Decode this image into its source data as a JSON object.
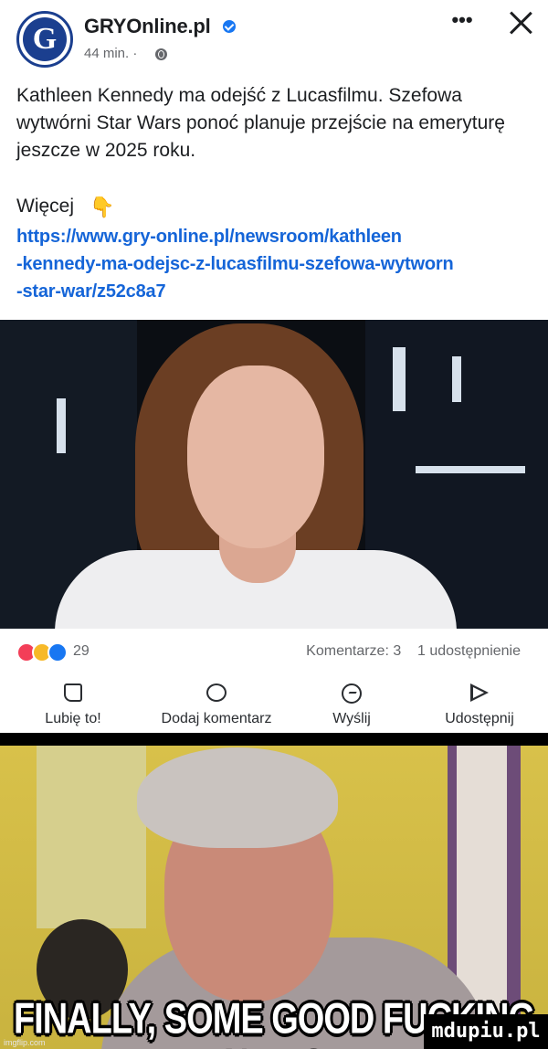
{
  "post": {
    "page_name": "GRYOnline.pl",
    "avatar_letter": "G",
    "time": "44 min. ·",
    "more_glyph": "•••",
    "text": "Kathleen Kennedy ma odejść z Lucasfilmu. Szefowa wytwórni Star Wars ponoć planuje przejście na emeryturę jeszcze w 2025 roku.",
    "more_label": "Więcej",
    "link_lines": [
      "https://www.gry-online.pl/newsroom/kathleen",
      "-kennedy-ma-odejsc-z-lucasfilmu-szefowa-wytworn",
      "-star-war/z52c8a7"
    ]
  },
  "engagement": {
    "reaction_count": "29",
    "comments": "Komentarze: 3",
    "shares": "1 udostępnienie"
  },
  "actions": {
    "like": "Lubię to!",
    "comment": "Dodaj komentarz",
    "send": "Wyślij",
    "share": "Udostępnij"
  },
  "meme": {
    "caption": "FINALLY, SOME GOOD FUCKING NEWS",
    "imgflip": "imgflip.com",
    "watermark": "mdupiu.pl"
  },
  "colors": {
    "link": "#1565d8",
    "verified": "#1877f2",
    "reaction_love": "#f33e58",
    "reaction_wow": "#f7b928",
    "reaction_like": "#1877f2"
  },
  "icons": [
    "verified-icon",
    "globe-icon",
    "more-icon",
    "close-icon",
    "pointing-hand-icon",
    "like-icon",
    "comment-icon",
    "messenger-icon",
    "share-icon"
  ]
}
